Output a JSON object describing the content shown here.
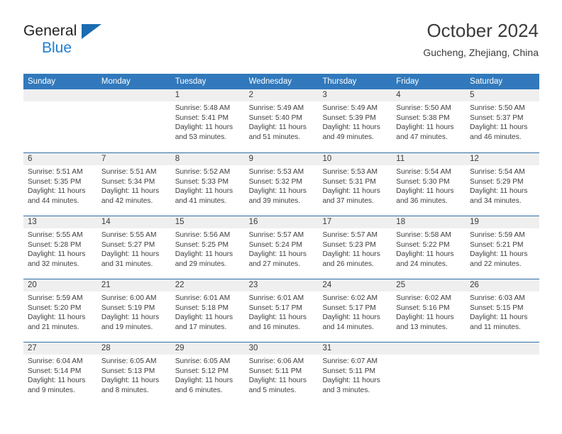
{
  "brand": {
    "line1": "General",
    "line2": "Blue",
    "triangle_color": "#1b6cb0",
    "blue_text_color": "#1f7fd0"
  },
  "header": {
    "title": "October 2024",
    "subtitle": "Gucheng, Zhejiang, China"
  },
  "theme": {
    "header_blue": "#3179bc",
    "row_divider": "#2f6ea8",
    "day_band_gray": "#efefef",
    "text": "#3d3d3d"
  },
  "weekday_headers": [
    "Sunday",
    "Monday",
    "Tuesday",
    "Wednesday",
    "Thursday",
    "Friday",
    "Saturday"
  ],
  "labels": {
    "sunrise_prefix": "Sunrise:",
    "sunset_prefix": "Sunset:",
    "daylight_prefix": "Daylight:"
  },
  "weeks": [
    [
      {
        "day": "",
        "sunrise": "",
        "sunset": "",
        "daylight_line1": "",
        "daylight_line2": "",
        "empty": true
      },
      {
        "day": "",
        "sunrise": "",
        "sunset": "",
        "daylight_line1": "",
        "daylight_line2": "",
        "empty": true
      },
      {
        "day": "1",
        "sunrise": "Sunrise: 5:48 AM",
        "sunset": "Sunset: 5:41 PM",
        "daylight_line1": "Daylight: 11 hours",
        "daylight_line2": "and 53 minutes.",
        "empty": false
      },
      {
        "day": "2",
        "sunrise": "Sunrise: 5:49 AM",
        "sunset": "Sunset: 5:40 PM",
        "daylight_line1": "Daylight: 11 hours",
        "daylight_line2": "and 51 minutes.",
        "empty": false
      },
      {
        "day": "3",
        "sunrise": "Sunrise: 5:49 AM",
        "sunset": "Sunset: 5:39 PM",
        "daylight_line1": "Daylight: 11 hours",
        "daylight_line2": "and 49 minutes.",
        "empty": false
      },
      {
        "day": "4",
        "sunrise": "Sunrise: 5:50 AM",
        "sunset": "Sunset: 5:38 PM",
        "daylight_line1": "Daylight: 11 hours",
        "daylight_line2": "and 47 minutes.",
        "empty": false
      },
      {
        "day": "5",
        "sunrise": "Sunrise: 5:50 AM",
        "sunset": "Sunset: 5:37 PM",
        "daylight_line1": "Daylight: 11 hours",
        "daylight_line2": "and 46 minutes.",
        "empty": false
      }
    ],
    [
      {
        "day": "6",
        "sunrise": "Sunrise: 5:51 AM",
        "sunset": "Sunset: 5:35 PM",
        "daylight_line1": "Daylight: 11 hours",
        "daylight_line2": "and 44 minutes.",
        "empty": false
      },
      {
        "day": "7",
        "sunrise": "Sunrise: 5:51 AM",
        "sunset": "Sunset: 5:34 PM",
        "daylight_line1": "Daylight: 11 hours",
        "daylight_line2": "and 42 minutes.",
        "empty": false
      },
      {
        "day": "8",
        "sunrise": "Sunrise: 5:52 AM",
        "sunset": "Sunset: 5:33 PM",
        "daylight_line1": "Daylight: 11 hours",
        "daylight_line2": "and 41 minutes.",
        "empty": false
      },
      {
        "day": "9",
        "sunrise": "Sunrise: 5:53 AM",
        "sunset": "Sunset: 5:32 PM",
        "daylight_line1": "Daylight: 11 hours",
        "daylight_line2": "and 39 minutes.",
        "empty": false
      },
      {
        "day": "10",
        "sunrise": "Sunrise: 5:53 AM",
        "sunset": "Sunset: 5:31 PM",
        "daylight_line1": "Daylight: 11 hours",
        "daylight_line2": "and 37 minutes.",
        "empty": false
      },
      {
        "day": "11",
        "sunrise": "Sunrise: 5:54 AM",
        "sunset": "Sunset: 5:30 PM",
        "daylight_line1": "Daylight: 11 hours",
        "daylight_line2": "and 36 minutes.",
        "empty": false
      },
      {
        "day": "12",
        "sunrise": "Sunrise: 5:54 AM",
        "sunset": "Sunset: 5:29 PM",
        "daylight_line1": "Daylight: 11 hours",
        "daylight_line2": "and 34 minutes.",
        "empty": false
      }
    ],
    [
      {
        "day": "13",
        "sunrise": "Sunrise: 5:55 AM",
        "sunset": "Sunset: 5:28 PM",
        "daylight_line1": "Daylight: 11 hours",
        "daylight_line2": "and 32 minutes.",
        "empty": false
      },
      {
        "day": "14",
        "sunrise": "Sunrise: 5:55 AM",
        "sunset": "Sunset: 5:27 PM",
        "daylight_line1": "Daylight: 11 hours",
        "daylight_line2": "and 31 minutes.",
        "empty": false
      },
      {
        "day": "15",
        "sunrise": "Sunrise: 5:56 AM",
        "sunset": "Sunset: 5:25 PM",
        "daylight_line1": "Daylight: 11 hours",
        "daylight_line2": "and 29 minutes.",
        "empty": false
      },
      {
        "day": "16",
        "sunrise": "Sunrise: 5:57 AM",
        "sunset": "Sunset: 5:24 PM",
        "daylight_line1": "Daylight: 11 hours",
        "daylight_line2": "and 27 minutes.",
        "empty": false
      },
      {
        "day": "17",
        "sunrise": "Sunrise: 5:57 AM",
        "sunset": "Sunset: 5:23 PM",
        "daylight_line1": "Daylight: 11 hours",
        "daylight_line2": "and 26 minutes.",
        "empty": false
      },
      {
        "day": "18",
        "sunrise": "Sunrise: 5:58 AM",
        "sunset": "Sunset: 5:22 PM",
        "daylight_line1": "Daylight: 11 hours",
        "daylight_line2": "and 24 minutes.",
        "empty": false
      },
      {
        "day": "19",
        "sunrise": "Sunrise: 5:59 AM",
        "sunset": "Sunset: 5:21 PM",
        "daylight_line1": "Daylight: 11 hours",
        "daylight_line2": "and 22 minutes.",
        "empty": false
      }
    ],
    [
      {
        "day": "20",
        "sunrise": "Sunrise: 5:59 AM",
        "sunset": "Sunset: 5:20 PM",
        "daylight_line1": "Daylight: 11 hours",
        "daylight_line2": "and 21 minutes.",
        "empty": false
      },
      {
        "day": "21",
        "sunrise": "Sunrise: 6:00 AM",
        "sunset": "Sunset: 5:19 PM",
        "daylight_line1": "Daylight: 11 hours",
        "daylight_line2": "and 19 minutes.",
        "empty": false
      },
      {
        "day": "22",
        "sunrise": "Sunrise: 6:01 AM",
        "sunset": "Sunset: 5:18 PM",
        "daylight_line1": "Daylight: 11 hours",
        "daylight_line2": "and 17 minutes.",
        "empty": false
      },
      {
        "day": "23",
        "sunrise": "Sunrise: 6:01 AM",
        "sunset": "Sunset: 5:17 PM",
        "daylight_line1": "Daylight: 11 hours",
        "daylight_line2": "and 16 minutes.",
        "empty": false
      },
      {
        "day": "24",
        "sunrise": "Sunrise: 6:02 AM",
        "sunset": "Sunset: 5:17 PM",
        "daylight_line1": "Daylight: 11 hours",
        "daylight_line2": "and 14 minutes.",
        "empty": false
      },
      {
        "day": "25",
        "sunrise": "Sunrise: 6:02 AM",
        "sunset": "Sunset: 5:16 PM",
        "daylight_line1": "Daylight: 11 hours",
        "daylight_line2": "and 13 minutes.",
        "empty": false
      },
      {
        "day": "26",
        "sunrise": "Sunrise: 6:03 AM",
        "sunset": "Sunset: 5:15 PM",
        "daylight_line1": "Daylight: 11 hours",
        "daylight_line2": "and 11 minutes.",
        "empty": false
      }
    ],
    [
      {
        "day": "27",
        "sunrise": "Sunrise: 6:04 AM",
        "sunset": "Sunset: 5:14 PM",
        "daylight_line1": "Daylight: 11 hours",
        "daylight_line2": "and 9 minutes.",
        "empty": false
      },
      {
        "day": "28",
        "sunrise": "Sunrise: 6:05 AM",
        "sunset": "Sunset: 5:13 PM",
        "daylight_line1": "Daylight: 11 hours",
        "daylight_line2": "and 8 minutes.",
        "empty": false
      },
      {
        "day": "29",
        "sunrise": "Sunrise: 6:05 AM",
        "sunset": "Sunset: 5:12 PM",
        "daylight_line1": "Daylight: 11 hours",
        "daylight_line2": "and 6 minutes.",
        "empty": false
      },
      {
        "day": "30",
        "sunrise": "Sunrise: 6:06 AM",
        "sunset": "Sunset: 5:11 PM",
        "daylight_line1": "Daylight: 11 hours",
        "daylight_line2": "and 5 minutes.",
        "empty": false
      },
      {
        "day": "31",
        "sunrise": "Sunrise: 6:07 AM",
        "sunset": "Sunset: 5:11 PM",
        "daylight_line1": "Daylight: 11 hours",
        "daylight_line2": "and 3 minutes.",
        "empty": false
      },
      {
        "day": "",
        "sunrise": "",
        "sunset": "",
        "daylight_line1": "",
        "daylight_line2": "",
        "empty": true
      },
      {
        "day": "",
        "sunrise": "",
        "sunset": "",
        "daylight_line1": "",
        "daylight_line2": "",
        "empty": true
      }
    ]
  ]
}
